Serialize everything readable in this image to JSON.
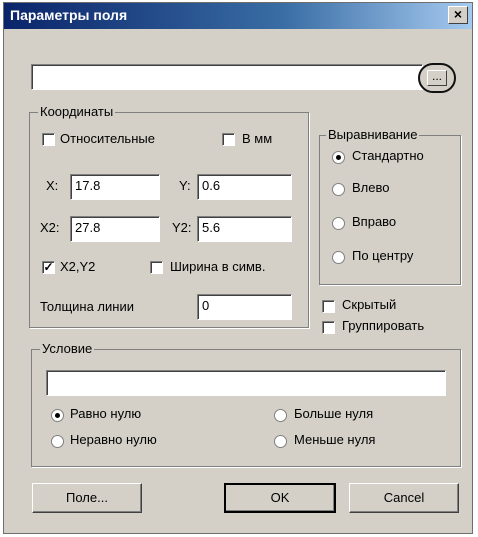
{
  "window": {
    "title": "Параметры поля",
    "close_glyph": "×"
  },
  "name_field": {
    "value": ""
  },
  "browse_button": {
    "label": "..."
  },
  "coords": {
    "legend": "Координаты",
    "relative_label": "Относительные",
    "relative_checked": false,
    "mm_label": "В мм",
    "mm_checked": false,
    "x_label": "X:",
    "x_value": "17.8",
    "y_label": "Y:",
    "y_value": "0.6",
    "x2_label": "X2:",
    "x2_value": "27.8",
    "y2_label": "Y2:",
    "y2_value": "5.6",
    "x2y2_label": "X2,Y2",
    "x2y2_checked": true,
    "width_chars_label": "Ширина в симв.",
    "width_chars_checked": false,
    "line_width_label": "Толщина линии",
    "line_width_value": "0"
  },
  "align": {
    "legend": "Выравнивание",
    "options": [
      "Стандартно",
      "Влево",
      "Вправо",
      "По центру"
    ],
    "selected": "Стандартно"
  },
  "hidden_label": "Скрытый",
  "hidden_checked": false,
  "group_label": "Группировать",
  "group_checked": false,
  "condition": {
    "legend": "Условие",
    "value": "",
    "options": [
      "Равно нулю",
      "Больше нуля",
      "Неравно нулю",
      "Меньше нуля"
    ],
    "selected": "Равно нулю"
  },
  "buttons": {
    "field": "Поле...",
    "ok": "OK",
    "cancel": "Cancel"
  },
  "colors": {
    "face": "#d4d0c8",
    "title_start": "#0a246a",
    "title_end": "#a6caf0"
  }
}
